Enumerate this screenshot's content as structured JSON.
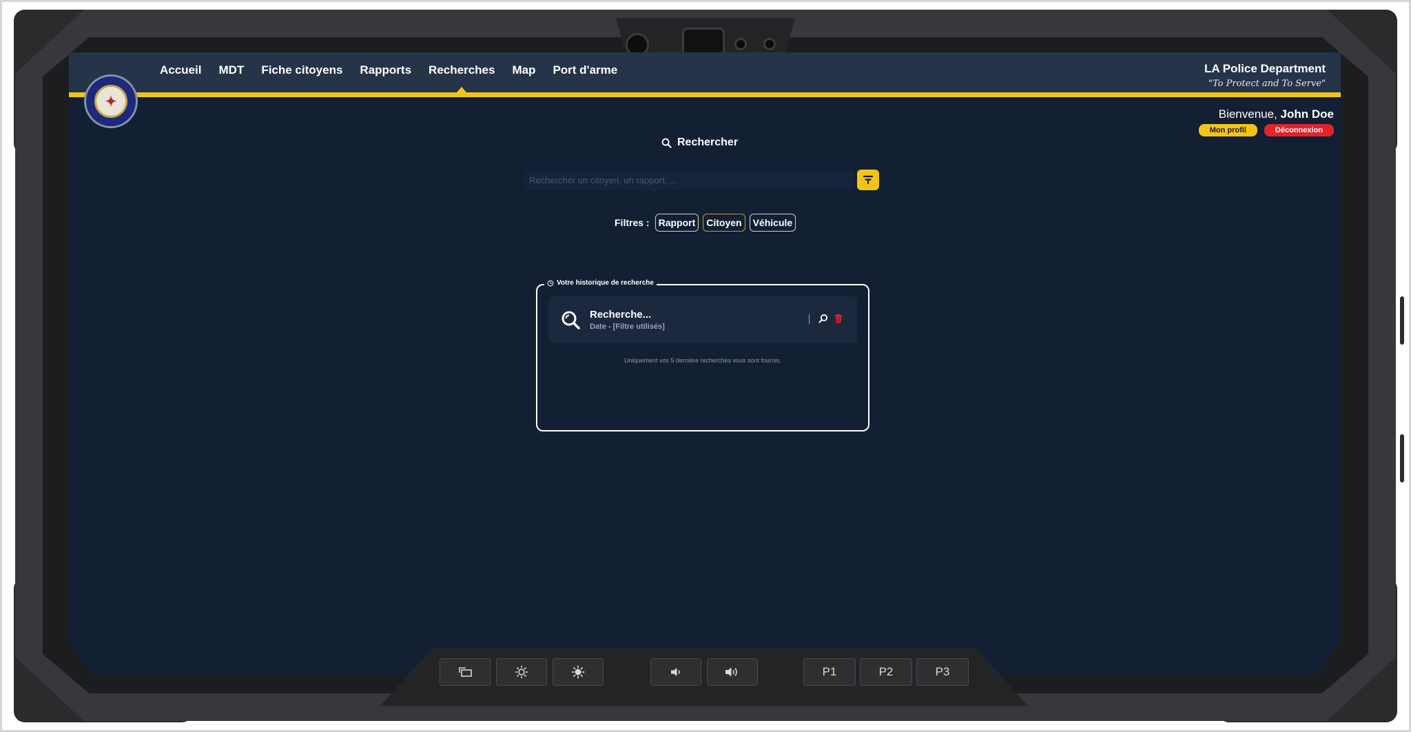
{
  "nav": {
    "items": [
      {
        "label": "Accueil"
      },
      {
        "label": "MDT"
      },
      {
        "label": "Fiche citoyens"
      },
      {
        "label": "Rapports"
      },
      {
        "label": "Recherches",
        "active": true
      },
      {
        "label": "Map"
      },
      {
        "label": "Port d'arme"
      }
    ]
  },
  "brand": {
    "title": "LA Police Department",
    "motto": "\"To Protect and To Serve\""
  },
  "user": {
    "greeting": "Bienvenue,",
    "name": "John Doe",
    "profile_label": "Mon profil",
    "logout_label": "Déconnexion"
  },
  "search": {
    "title": "Rechercher",
    "placeholder": "Rechercher un citoyen, un rapport, ...",
    "value": ""
  },
  "filters": {
    "label": "Filtres :",
    "options": [
      {
        "label": "Rapport",
        "active": false
      },
      {
        "label": "Citoyen",
        "active": true
      },
      {
        "label": "Véhicule",
        "active": false
      }
    ]
  },
  "history": {
    "title": "Votre historique de recherche",
    "items": [
      {
        "title": "Recherche...",
        "subtitle": "Date - [Filtre utilisés]"
      }
    ],
    "note": "Uniquement vos 5 dernière recherches vous sont fournis."
  },
  "hardware_keys": {
    "p1": "P1",
    "p2": "P2",
    "p3": "P3"
  },
  "colors": {
    "accent": "#f3c317",
    "danger": "#e3232b",
    "screen_bg": "#131f33",
    "topbar_bg": "#263449"
  }
}
